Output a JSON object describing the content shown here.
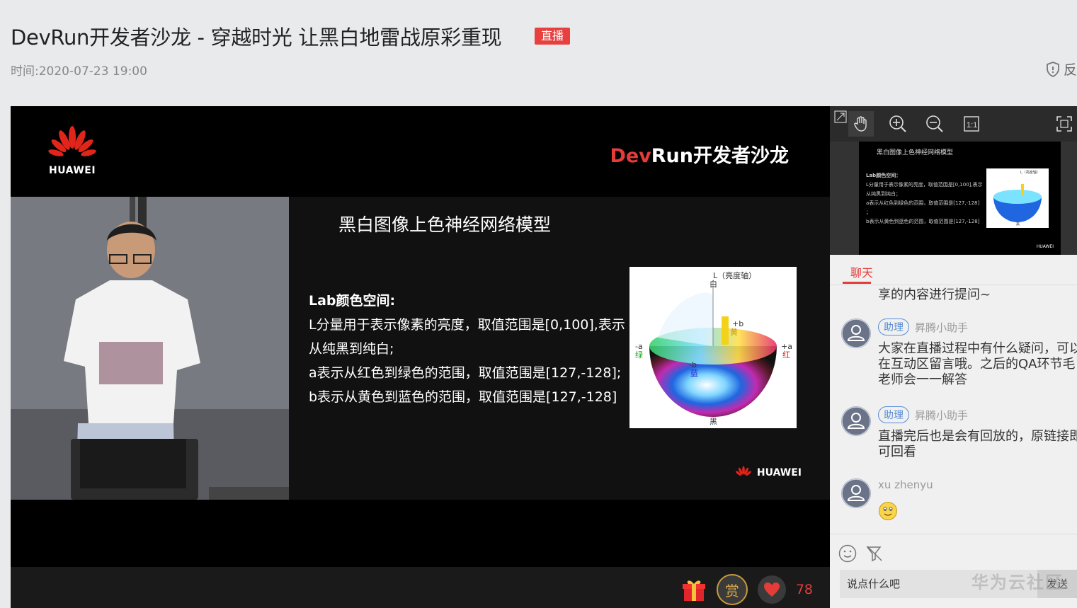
{
  "page": {
    "title": "DevRun开发者沙龙 - 穿越时光 让黑白地雷战原彩重现",
    "live_badge": "直播",
    "time_label": "时间:",
    "time_value": "2020-07-23 19:00",
    "report_label": "反"
  },
  "slide": {
    "logo_text": "HUAWEI",
    "brand_dev": "Dev",
    "brand_rest": "Run开发者沙龙",
    "heading": "黑白图像上色神经网络模型",
    "lines": [
      "Lab颜色空间:",
      "L分量用于表示像素的亮度，取值范围是[0,100],表示",
      "从纯黑到纯白;",
      "a表示从红色到绿色的范围，取值范围是[127,-128];",
      "b表示从黄色到蓝色的范围，取值范围是[127,-128]"
    ],
    "lab_axis_label": "L（亮度轴）",
    "lab_white": "白",
    "lab_black": "黑",
    "lab_plus_a": "+a",
    "lab_red": "红",
    "lab_minus_a": "-a",
    "lab_green": "绿",
    "lab_plus_b": "+b",
    "lab_yellow": "黄",
    "lab_minus_b": "-b",
    "lab_blue": "蓝",
    "footer_logo_text": "HUAWEI"
  },
  "player": {
    "like_count": "78",
    "reward_label": "赏"
  },
  "thumbnail": {
    "title": "黑白图像上色神经网络模型",
    "lines": [
      "Lab颜色空间：",
      "L分量用于表示像素的亮度，取值范围是[0,100],表示",
      "从纯黑到纯白；",
      "a表示从红色到绿色的范围，取值范围是[127,-128]",
      "；",
      "b表示从黄色到蓝色的范围，取值范围是[127,-128]"
    ],
    "image_label": "L（亮度轴）",
    "image_label_bottom": "黑",
    "logo_text": "HUAWEI"
  },
  "chat": {
    "tab_label": "聊天",
    "partial_text": "享的内容进行提问~",
    "messages": [
      {
        "role": "助理",
        "name": "昇腾小助手",
        "text": "大家在直播过程中有什么疑问，可以\n在互动区留言哦。之后的QA环节毛\n老师会一一解答"
      },
      {
        "role": "助理",
        "name": "昇腾小助手",
        "text": "直播完后也是会有回放的，原链接即\n可回看"
      },
      {
        "role": "",
        "name": "xu zhenyu",
        "text": ""
      }
    ],
    "input_placeholder": "说点什么吧",
    "send_label": "发送"
  },
  "watermark": "华为云社区",
  "colors": {
    "accent_red": "#e33c39",
    "assistant_blue": "#5a8dd6",
    "background": "#e9eaec"
  },
  "icons": [
    "shield-icon",
    "expand-icon",
    "hand-icon",
    "zoom-in-icon",
    "zoom-out-icon",
    "actual-size-icon",
    "fullscreen-icon",
    "gift-icon",
    "heart-icon",
    "emoji-icon",
    "filter-icon",
    "user-avatar-icon",
    "smile-emoji-icon"
  ]
}
